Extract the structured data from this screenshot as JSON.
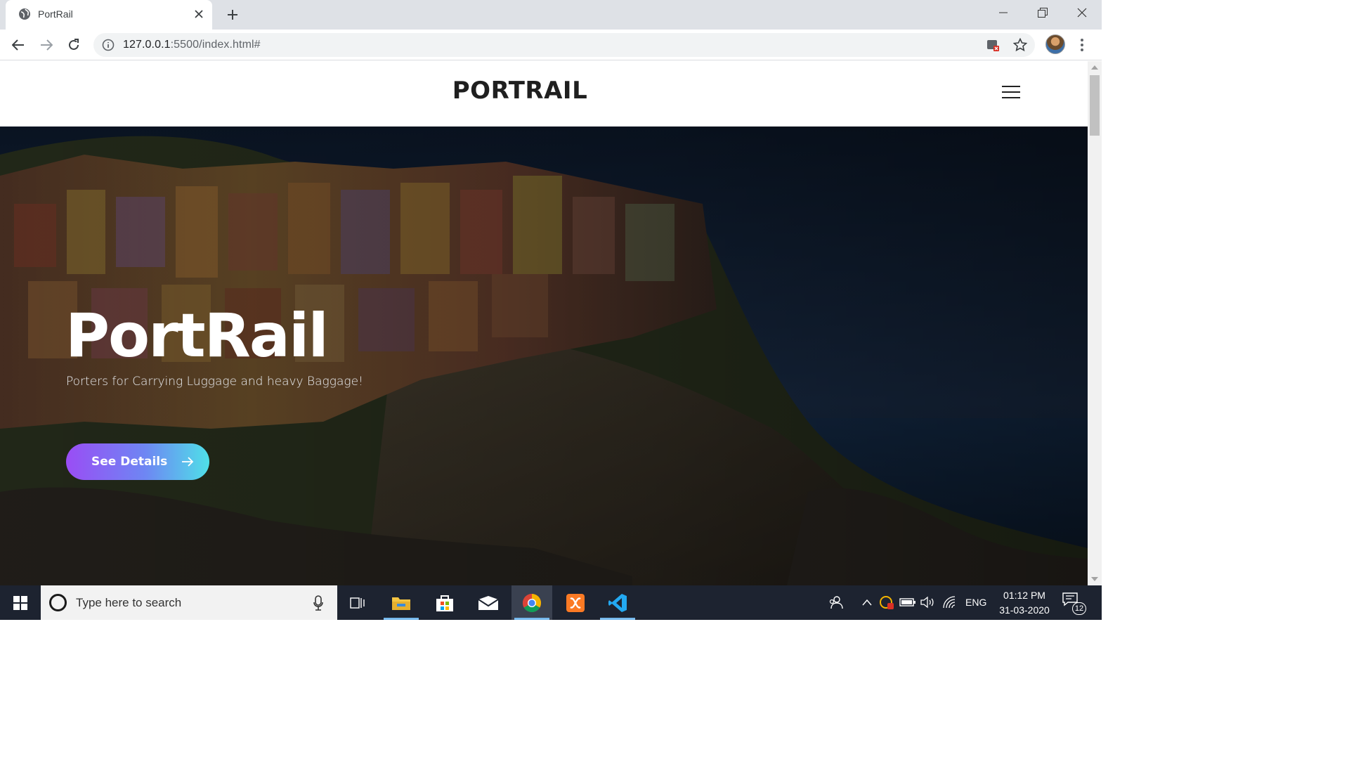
{
  "browser": {
    "tab_title": "PortRail",
    "url_host": "127.0.0.1",
    "url_rest": ":5500/index.html#"
  },
  "site": {
    "brand": "PORTRAIL",
    "hero_title": "PortRail",
    "hero_subtitle": "Porters for Carrying Luggage and heavy Baggage!",
    "cta_label": "See Details"
  },
  "taskbar": {
    "search_placeholder": "Type here to search",
    "language": "ENG",
    "time": "01:12 PM",
    "date": "31-03-2020",
    "notification_count": "12"
  },
  "colors": {
    "cta_gradient_start": "#9a4df5",
    "cta_gradient_end": "#4fe0e8",
    "taskbar_bg": "#1d2330"
  }
}
